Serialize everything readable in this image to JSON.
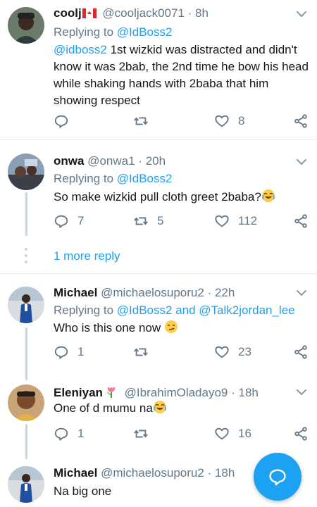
{
  "tweets": [
    {
      "name": "coolj",
      "handle": "@cooljack0071",
      "dot": "·",
      "time": "8h",
      "flag": "canada-flag",
      "reply_prefix": "Replying to ",
      "reply_target": "@IdBoss2",
      "mention": "@idboss2",
      "text": " 1st wizkid was distracted and didn't know it was 2bab, the 2nd time he bow his head while shaking hands with 2baba that him showing respect",
      "reply_count": "",
      "retweet_count": "",
      "like_count": "8"
    },
    {
      "name": "onwa",
      "handle": "@onwa1",
      "dot": "·",
      "time": "20h",
      "reply_prefix": "Replying to ",
      "reply_target": "@IdBoss2",
      "text": "So make wizkid pull cloth greet 2baba?",
      "emoji": "joy-emoji",
      "reply_count": "7",
      "retweet_count": "5",
      "like_count": "112"
    },
    {
      "name": "Michael",
      "handle": "@michaelosuporu2",
      "dot": "·",
      "time": "22h",
      "reply_prefix": "Replying to ",
      "reply_target": "@IdBoss2 and @Talk2jordan_lee",
      "text": "Who is this one now ",
      "emoji": "smirk-emoji",
      "reply_count": "1",
      "retweet_count": "",
      "like_count": "23"
    },
    {
      "name": "Eleniyan",
      "name_emoji": "tulip-emoji",
      "handle": "@IbrahimOladayo9",
      "dot": "·",
      "time": "18h",
      "text": "One of d mumu na",
      "emoji": "joy-emoji",
      "reply_count": "1",
      "retweet_count": "",
      "like_count": "16"
    },
    {
      "name": "Michael",
      "handle": "@michaelosuporu2",
      "dot": "·",
      "time": "18h",
      "text": "Na big one"
    }
  ],
  "more_replies": "1 more reply",
  "colors": {
    "accent": "#1da1f2",
    "secondary": "#657786",
    "text": "#14171a",
    "divider": "#e6ecf0"
  }
}
